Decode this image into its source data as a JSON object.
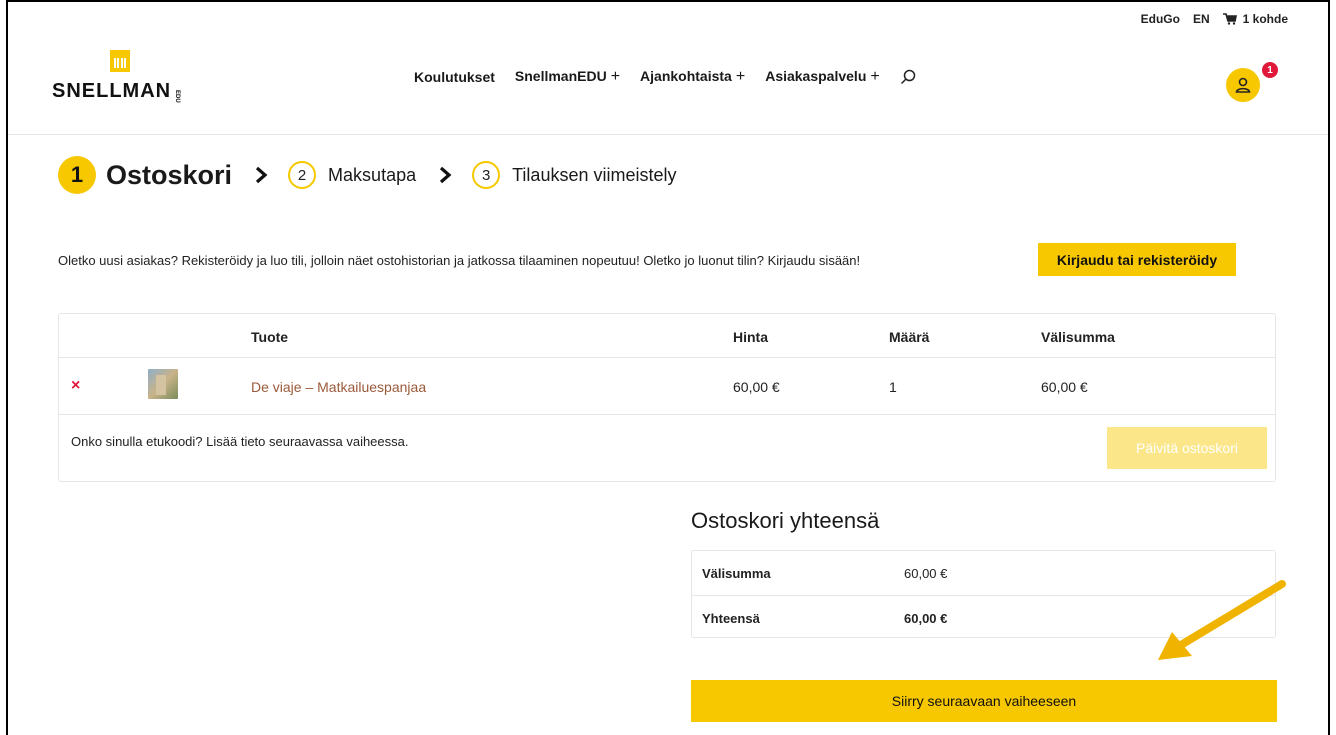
{
  "utility": {
    "brand_link": "EduGo",
    "lang": "EN",
    "cart_count": "1 kohde"
  },
  "logo": {
    "text": "SNELLMAN",
    "suffix": "EDU"
  },
  "nav": {
    "items": [
      {
        "label": "Koulutukset",
        "has_plus": false
      },
      {
        "label": "SnellmanEDU",
        "has_plus": true
      },
      {
        "label": "Ajankohtaista",
        "has_plus": true
      },
      {
        "label": "Asiakaspalvelu",
        "has_plus": true
      }
    ],
    "plus": "+"
  },
  "user": {
    "badge": "1"
  },
  "steps": [
    {
      "num": "1",
      "label": "Ostoskori"
    },
    {
      "num": "2",
      "label": "Maksutapa"
    },
    {
      "num": "3",
      "label": "Tilauksen viimeistely"
    }
  ],
  "notice": {
    "text": "Oletko uusi asiakas? Rekisteröidy ja luo tili, jolloin näet ostohistorian ja jatkossa tilaaminen nopeutuu! Oletko jo luonut tilin? Kirjaudu sisään!",
    "button": "Kirjaudu tai rekisteröidy"
  },
  "cart": {
    "headers": {
      "product": "Tuote",
      "price": "Hinta",
      "qty": "Määrä",
      "subtotal": "Välisumma"
    },
    "items": [
      {
        "remove": "×",
        "name": "De viaje – Matkailuespanjaa",
        "price": "60,00 €",
        "qty": "1",
        "subtotal": "60,00 €"
      }
    ],
    "coupon_text": "Onko sinulla etukoodi? Lisää tieto seuraavassa vaiheessa.",
    "update_button": "Päivitä ostoskori"
  },
  "totals": {
    "title": "Ostoskori yhteensä",
    "rows": [
      {
        "label": "Välisumma",
        "value": "60,00 €"
      },
      {
        "label": "Yhteensä",
        "value": "60,00 €"
      }
    ],
    "next_button": "Siirry seuraavaan vaiheeseen"
  },
  "colors": {
    "accent": "#f7c800",
    "remove": "#e0193b",
    "link": "#9b5a3a",
    "arrow": "#f0b400"
  }
}
